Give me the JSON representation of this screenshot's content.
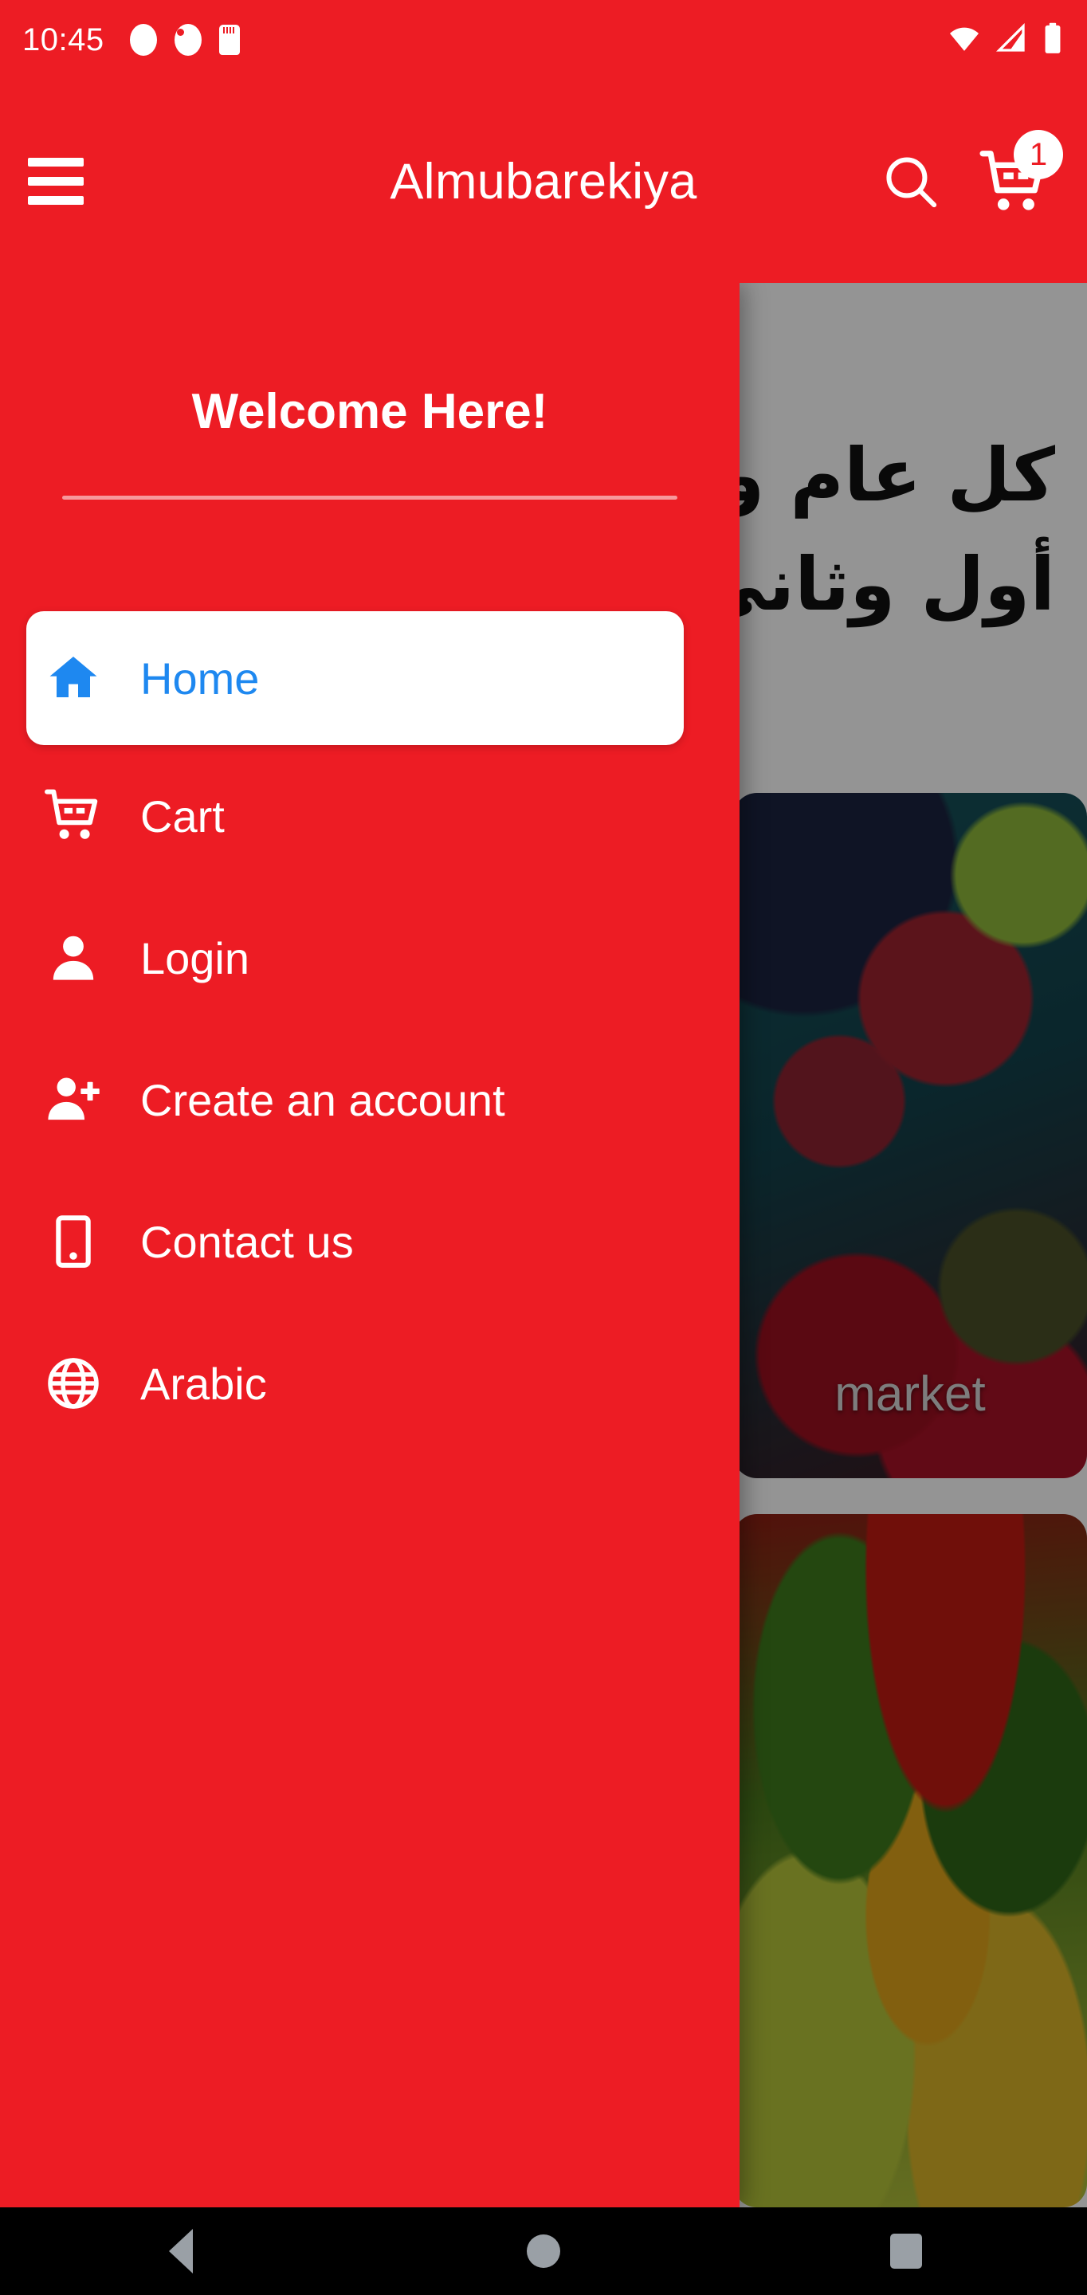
{
  "status_bar": {
    "time": "10:45",
    "left_icons": [
      "notification-dot-icon",
      "battery-saver-icon",
      "sd-card-icon"
    ],
    "right_icons": [
      "wifi-icon",
      "cellular-signal-icon",
      "battery-icon"
    ]
  },
  "app_bar": {
    "menu_icon": "hamburger-menu-icon",
    "title": "Almubarekiya",
    "search_icon": "search-icon",
    "cart_icon": "shopping-cart-icon",
    "cart_badge_count": "1"
  },
  "drawer": {
    "welcome_text": "Welcome Here!",
    "items": [
      {
        "label": "Home",
        "icon": "home-icon",
        "selected": true
      },
      {
        "label": "Cart",
        "icon": "shopping-cart-icon",
        "selected": false
      },
      {
        "label": "Login",
        "icon": "person-icon",
        "selected": false
      },
      {
        "label": "Create an account",
        "icon": "person-add-icon",
        "selected": false
      },
      {
        "label": "Contact us",
        "icon": "mobile-phone-icon",
        "selected": false
      },
      {
        "label": "Arabic",
        "icon": "globe-icon",
        "selected": false
      }
    ]
  },
  "content": {
    "banner_line_1": "كل عام وأنتم",
    "banner_line_2": "أول وثاني",
    "cards": [
      {
        "label": "market",
        "image": "fresh-fruit-photo"
      },
      {
        "label": "",
        "image": "vegetable-market-photo"
      }
    ]
  },
  "nav_bar": {
    "back_label": "back-button",
    "home_label": "home-button",
    "recents_label": "recents-button"
  },
  "colors": {
    "brand_red": "#ED1C24",
    "accent_blue": "#1E88F0",
    "scrim": "rgba(0,0,0,0.42)",
    "nav_bar_black": "#000000"
  }
}
